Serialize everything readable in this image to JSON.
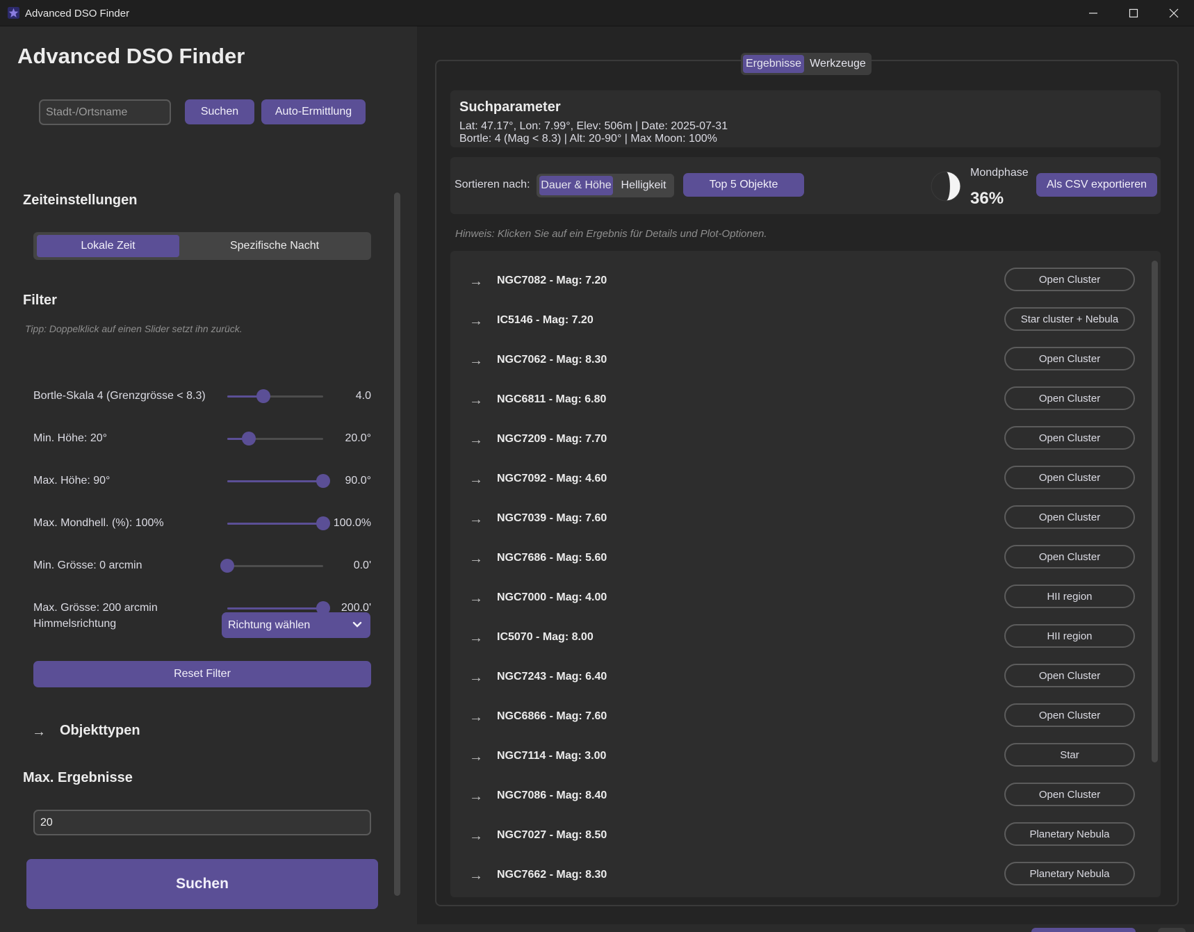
{
  "window": {
    "title": "Advanced DSO Finder",
    "controls": [
      "minimize-icon",
      "maximize-icon",
      "close-icon"
    ]
  },
  "colors": {
    "accent": "#5b4f96",
    "background": "#242424",
    "sidebar": "#2b2b2b",
    "panel": "#2d2d2d"
  },
  "sidebar": {
    "app_title": "Advanced DSO Finder",
    "location": {
      "placeholder": "Stadt-/Ortsname",
      "search_label": "Suchen",
      "auto_label": "Auto-Ermittlung"
    },
    "time": {
      "title": "Zeiteinstellungen",
      "options": [
        "Lokale Zeit",
        "Spezifische Nacht"
      ],
      "selected": "Lokale Zeit"
    },
    "filter": {
      "title": "Filter",
      "tip": "Tipp: Doppelklick auf einen Slider setzt ihn zurück.",
      "sliders": [
        {
          "label": "Bortle-Skala 4 (Grenzgrösse < 8.3)",
          "value_text": "4.0",
          "fraction": 0.375
        },
        {
          "label": "Min. Höhe: 20°",
          "value_text": "20.0°",
          "fraction": 0.222
        },
        {
          "label": "Max. Höhe: 90°",
          "value_text": "90.0°",
          "fraction": 1.0
        },
        {
          "label": "Max. Mondhell. (%): 100%",
          "value_text": "100.0%",
          "fraction": 1.0
        },
        {
          "label": "Min. Grösse: 0 arcmin",
          "value_text": "0.0'",
          "fraction": 0.0
        },
        {
          "label": "Max. Grösse: 200 arcmin",
          "value_text": "200.0'",
          "fraction": 1.0
        }
      ],
      "direction_label": "Himmelsrichtung",
      "direction_value": "Richtung wählen",
      "reset_label": "Reset Filter"
    },
    "object_types_label": "Objekttypen",
    "max_results": {
      "title": "Max. Ergebnisse",
      "value": "20"
    },
    "search_label": "Suchen"
  },
  "main": {
    "tabs": [
      "Ergebnisse",
      "Werkzeuge"
    ],
    "active_tab": "Ergebnisse",
    "params": {
      "title": "Suchparameter",
      "line1": "Lat: 47.17°, Lon: 7.99°, Elev: 506m | Date: 2025-07-31",
      "line2": "Bortle: 4 (Mag < 8.3) | Alt: 20-90° | Max Moon: 100%"
    },
    "toolbar": {
      "sort_label": "Sortieren nach:",
      "sort_options": [
        "Dauer & Höhe",
        "Helligkeit"
      ],
      "sort_selected": "Dauer & Höhe",
      "top5_label": "Top 5 Objekte",
      "moon_label": "Mondphase",
      "moon_pct": "36%",
      "moon_fraction": 0.36,
      "export_label": "Als CSV exportieren"
    },
    "hint": "Hinweis: Klicken Sie auf ein Ergebnis für Details und Plot-Optionen.",
    "results": [
      {
        "title": "NGC7082 - Mag: 7.20",
        "type": "Open Cluster"
      },
      {
        "title": "IC5146 - Mag: 7.20",
        "type": "Star cluster + Nebula"
      },
      {
        "title": "NGC7062 - Mag: 8.30",
        "type": "Open Cluster"
      },
      {
        "title": "NGC6811 - Mag: 6.80",
        "type": "Open Cluster"
      },
      {
        "title": "NGC7209 - Mag: 7.70",
        "type": "Open Cluster"
      },
      {
        "title": "NGC7092 - Mag: 4.60",
        "type": "Open Cluster"
      },
      {
        "title": "NGC7039 - Mag: 7.60",
        "type": "Open Cluster"
      },
      {
        "title": "NGC7686 - Mag: 5.60",
        "type": "Open Cluster"
      },
      {
        "title": "NGC7000 - Mag: 4.00",
        "type": "HII region"
      },
      {
        "title": "IC5070 - Mag: 8.00",
        "type": "HII region"
      },
      {
        "title": "NGC7243 - Mag: 6.40",
        "type": "Open Cluster"
      },
      {
        "title": "NGC6866 - Mag: 7.60",
        "type": "Open Cluster"
      },
      {
        "title": "NGC7114 - Mag: 3.00",
        "type": "Star"
      },
      {
        "title": "NGC7086 - Mag: 8.40",
        "type": "Open Cluster"
      },
      {
        "title": "NGC7027 - Mag: 8.50",
        "type": "Planetary Nebula"
      },
      {
        "title": "NGC7662 - Mag: 8.30",
        "type": "Planetary Nebula"
      }
    ]
  }
}
